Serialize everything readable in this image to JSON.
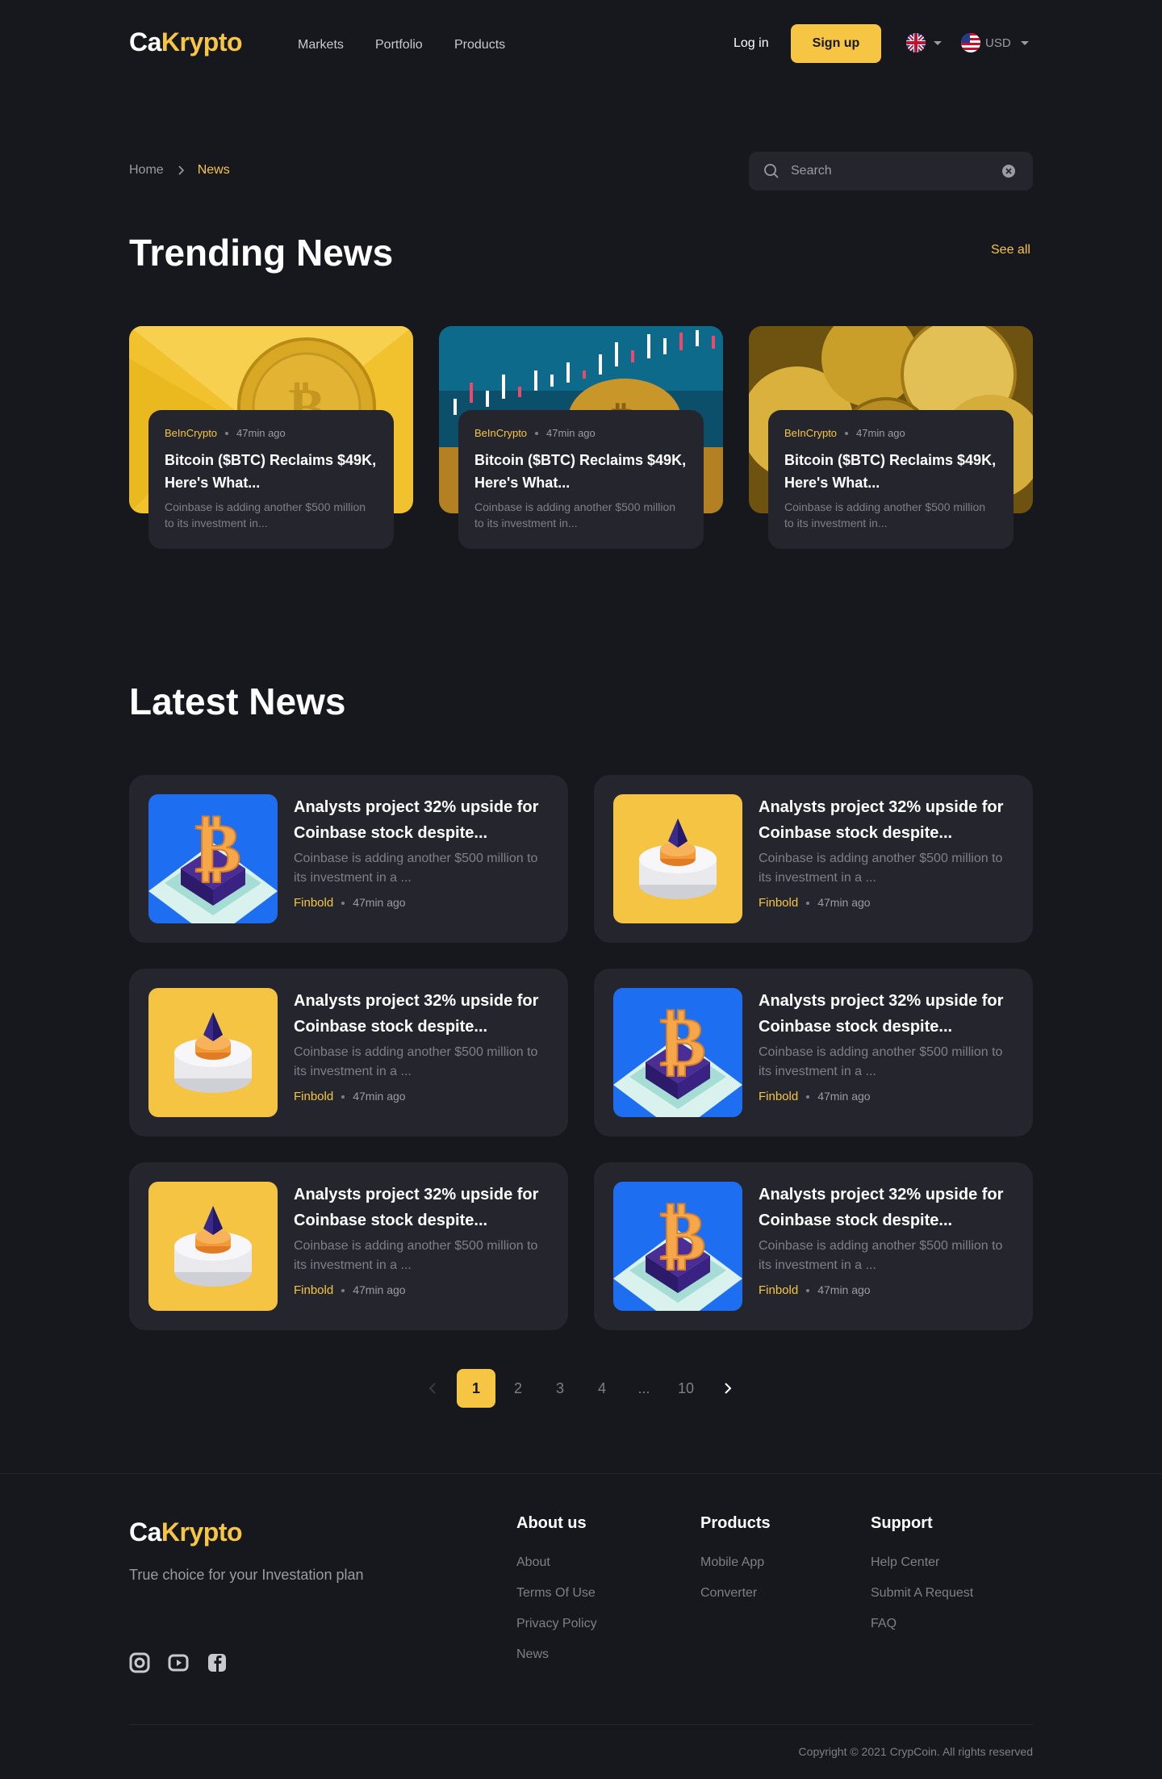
{
  "header": {
    "logo_part1": "Ca",
    "logo_part2": "Krypto",
    "nav": [
      "Markets",
      "Portfolio",
      "Products"
    ],
    "login": "Log in",
    "signup": "Sign up",
    "currency": "USD"
  },
  "breadcrumb": {
    "home": "Home",
    "current": "News"
  },
  "search": {
    "placeholder": "Search"
  },
  "trending": {
    "title": "Trending News",
    "see_all": "See all",
    "items": [
      {
        "source": "BeInCrypto",
        "time": "47min ago",
        "title": "Bitcoin ($BTC) Reclaims $49K, Here's What...",
        "desc": "Coinbase is adding another $500 million to its investment in..."
      },
      {
        "source": "BeInCrypto",
        "time": "47min ago",
        "title": "Bitcoin ($BTC) Reclaims $49K, Here's What...",
        "desc": "Coinbase is adding another $500 million to its investment in..."
      },
      {
        "source": "BeInCrypto",
        "time": "47min ago",
        "title": "Bitcoin ($BTC) Reclaims $49K, Here's What...",
        "desc": "Coinbase is adding another $500 million to its investment in..."
      }
    ]
  },
  "latest": {
    "title": "Latest News",
    "items": [
      {
        "image": "bitcoin-blue",
        "title": "Analysts project 32% upside for Coinbase stock despite...",
        "desc": "Coinbase is adding another $500 million to its investment in a ...",
        "source": "Finbold",
        "time": "47min ago"
      },
      {
        "image": "ethereum-yellow",
        "title": "Analysts project 32% upside for Coinbase stock despite...",
        "desc": "Coinbase is adding another $500 million to its investment in a ...",
        "source": "Finbold",
        "time": "47min ago"
      },
      {
        "image": "ethereum-yellow",
        "title": "Analysts project 32% upside for Coinbase stock despite...",
        "desc": "Coinbase is adding another $500 million to its investment in a ...",
        "source": "Finbold",
        "time": "47min ago"
      },
      {
        "image": "bitcoin-blue",
        "title": "Analysts project 32% upside for Coinbase stock despite...",
        "desc": "Coinbase is adding another $500 million to its investment in a ...",
        "source": "Finbold",
        "time": "47min ago"
      },
      {
        "image": "ethereum-yellow",
        "title": "Analysts project 32% upside for Coinbase stock despite...",
        "desc": "Coinbase is adding another $500 million to its investment in a ...",
        "source": "Finbold",
        "time": "47min ago"
      },
      {
        "image": "bitcoin-blue",
        "title": "Analysts project 32% upside for Coinbase stock despite...",
        "desc": "Coinbase is adding another $500 million to its investment in a ...",
        "source": "Finbold",
        "time": "47min ago"
      }
    ]
  },
  "pagination": {
    "pages": [
      "1",
      "2",
      "3",
      "4",
      "...",
      "10"
    ],
    "current": "1"
  },
  "footer": {
    "logo_part1": "Ca",
    "logo_part2": "Krypto",
    "tagline": "True choice for your Investation plan",
    "columns": [
      {
        "title": "About us",
        "links": [
          "About",
          "Terms Of Use",
          "Privacy Policy",
          "News"
        ]
      },
      {
        "title": "Products",
        "links": [
          "Mobile App",
          "Converter"
        ]
      },
      {
        "title": "Support",
        "links": [
          "Help Center",
          "Submit A Request",
          "FAQ"
        ]
      }
    ],
    "social": [
      "instagram-icon",
      "youtube-icon",
      "facebook-icon"
    ],
    "copyright": "Copyright © 2021 CrypCoin. All rights reserved"
  },
  "colors": {
    "accent": "#f7c544",
    "background": "#17181d",
    "card": "#25262d"
  }
}
